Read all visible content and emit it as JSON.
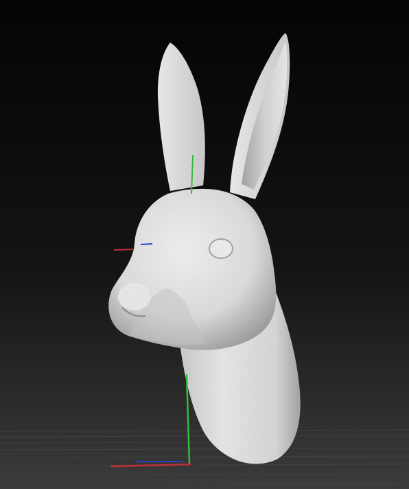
{
  "viewport": {
    "background_top": "#050505",
    "background_bottom": "#3a3a3a",
    "floor_grid_color": "#4a4a4a"
  },
  "model": {
    "name": "rabbit-head-sculpt",
    "surface_color": "#e9e9e9",
    "shadow_color": "#9c9c9c",
    "inner_ear_color": "#bdbdbd"
  },
  "gizmo": {
    "x_axis_color": "#c0303a",
    "y_axis_color": "#2fbf3a",
    "z_axis_color": "#3040c8"
  }
}
